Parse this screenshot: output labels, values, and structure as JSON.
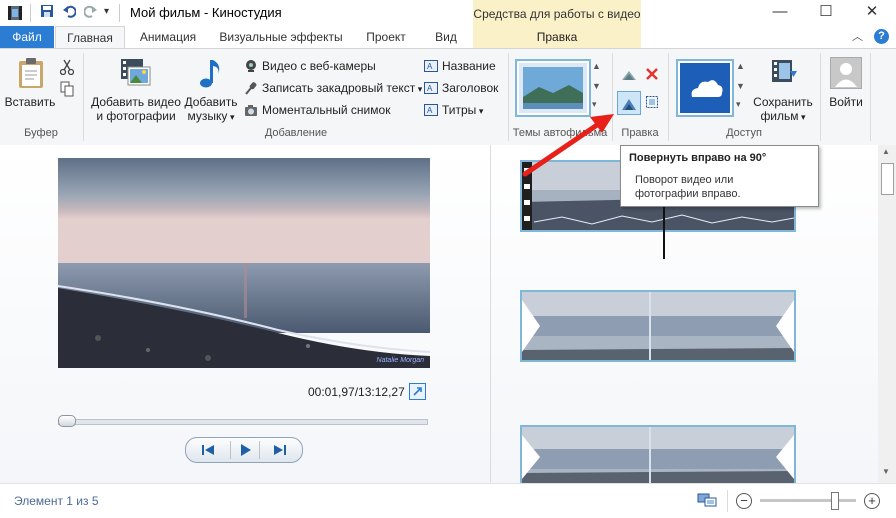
{
  "window": {
    "title": "Мой фильм - Киностудия",
    "contextual_group": "Средства для работы с видео",
    "contextual_tab": "Правка"
  },
  "tabs": [
    "Файл",
    "Главная",
    "Анимация",
    "Визуальные эффекты",
    "Проект",
    "Вид"
  ],
  "ribbon": {
    "clipboard": {
      "paste": "Вставить",
      "group": "Буфер"
    },
    "add": {
      "add_video_line1": "Добавить видео",
      "add_video_line2": "и фотографии",
      "add_music_line1": "Добавить",
      "add_music_line2": "музыку",
      "webcam": "Видео с веб-камеры",
      "record_voice": "Записать закадровый текст",
      "snapshot": "Моментальный снимок",
      "caption_title": "Название",
      "caption_header": "Заголовок",
      "caption_credits": "Титры",
      "group": "Добавление"
    },
    "themes": {
      "group": "Темы автофильма"
    },
    "edit": {
      "group": "Правка"
    },
    "share": {
      "save_line1": "Сохранить",
      "save_line2": "фильм",
      "group": "Доступ"
    },
    "account": {
      "signin": "Войти"
    }
  },
  "tooltip": {
    "title": "Повернуть вправо на 90°",
    "line1": "Поворот видео или",
    "line2": "фотографии вправо."
  },
  "preview": {
    "time": "00:01,97/13:12,27",
    "watermark": "Natalie Morgan"
  },
  "status": {
    "item": "Элемент 1 из 5"
  },
  "zoom": {
    "level_fraction": 0.83
  },
  "colors": {
    "accent": "#2b7cd3",
    "context_tab": "#fbf1c8",
    "arrow": "#e8201a"
  }
}
